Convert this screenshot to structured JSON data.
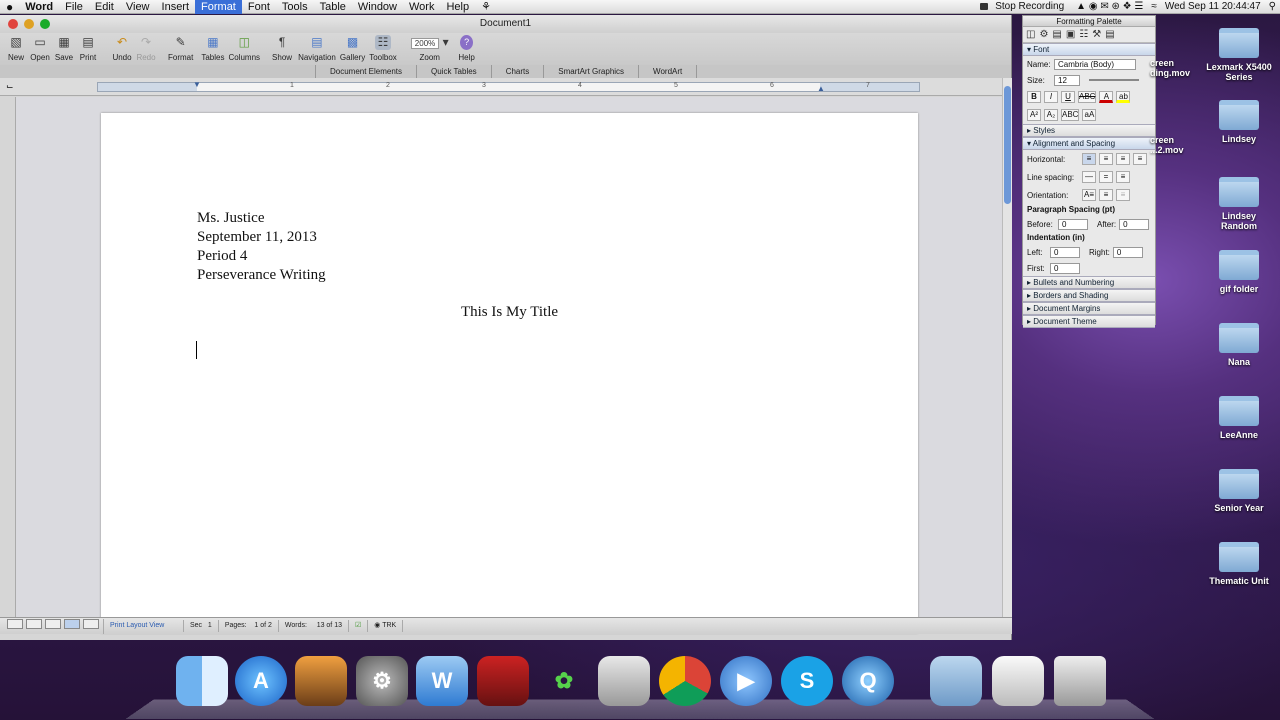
{
  "menubar": {
    "apple": "",
    "app_name": "Word",
    "items": [
      "File",
      "Edit",
      "View",
      "Insert",
      "Format",
      "Font",
      "Tools",
      "Table",
      "Window",
      "Work",
      "Help"
    ],
    "active_item": "Format",
    "script_glyph": "⚘",
    "right": {
      "stop_recording": "Stop Recording",
      "clock": "Wed Sep 11  20:44:47"
    }
  },
  "window": {
    "title": "Document1",
    "toolbar": [
      {
        "label": "New",
        "icon": "new-icon"
      },
      {
        "label": "Open",
        "icon": "open-icon"
      },
      {
        "label": "Save",
        "icon": "save-icon"
      },
      {
        "label": "Print",
        "icon": "print-icon"
      },
      {
        "label": "Undo",
        "icon": "undo-icon"
      },
      {
        "label": "Redo",
        "icon": "redo-icon"
      },
      {
        "label": "Format",
        "icon": "format-icon"
      },
      {
        "label": "Tables",
        "icon": "tables-icon"
      },
      {
        "label": "Columns",
        "icon": "columns-icon"
      },
      {
        "label": "Show",
        "icon": "pilcrow-icon"
      },
      {
        "label": "Navigation",
        "icon": "navigation-icon"
      },
      {
        "label": "Gallery",
        "icon": "gallery-icon"
      },
      {
        "label": "Toolbox",
        "icon": "toolbox-icon"
      },
      {
        "label": "Zoom",
        "icon": "zoom-icon"
      },
      {
        "label": "Help",
        "icon": "help-icon"
      }
    ],
    "zoom_value": "200%",
    "ribbon_tabs": [
      "Document Elements",
      "Quick Tables",
      "Charts",
      "SmartArt Graphics",
      "WordArt"
    ],
    "ruler_numbers": [
      "1",
      "2",
      "3",
      "4",
      "5",
      "6",
      "7"
    ]
  },
  "document": {
    "lines": [
      "Ms. Justice",
      "September 11, 2013",
      "Period 4",
      "Perseverance Writing"
    ],
    "title": "This Is My Title"
  },
  "statusbar": {
    "view": "Print Layout View",
    "sec_label": "Sec",
    "sec_value": "1",
    "pages_label": "Pages:",
    "pages_value": "1 of 2",
    "words_label": "Words:",
    "words_value": "13 of 13",
    "trk": "TRK"
  },
  "palette": {
    "title": "Formatting Palette",
    "font_section": "Font",
    "name_label": "Name:",
    "name_value": "Cambria (Body)",
    "size_label": "Size:",
    "size_value": "12",
    "styles": "Styles",
    "align_section": "Alignment and Spacing",
    "horizontal": "Horizontal:",
    "line_spacing": "Line spacing:",
    "orientation": "Orientation:",
    "para_spacing": "Paragraph Spacing (pt)",
    "before_label": "Before:",
    "before_value": "0",
    "after_label": "After:",
    "after_value": "0",
    "indent": "Indentation (in)",
    "left_label": "Left:",
    "left_value": "0",
    "right_label": "Right:",
    "right_value": "0",
    "first_label": "First:",
    "first_value": "0",
    "bullets": "Bullets and Numbering",
    "borders": "Borders and Shading",
    "margins": "Document Margins",
    "theme": "Document Theme"
  },
  "desktop": {
    "items": [
      "Lexmark X5400 Series",
      "Lindsey",
      "Lindsey Random",
      "gif folder",
      "Nana",
      "LeeAnne",
      "Senior Year",
      "Thematic Unit"
    ],
    "partial_labels": [
      "creen",
      "ding.mov",
      "creen",
      "...2.mov"
    ]
  },
  "dock": {
    "items": [
      "finder-icon",
      "app-store-icon",
      "iphoto-icon",
      "system-preferences-icon",
      "word-icon",
      "photo-booth-icon",
      "messages-icon",
      "photos-icon",
      "chrome-icon",
      "facetime-icon",
      "skype-icon",
      "quicktime-icon",
      "applications-folder-icon",
      "documents-icon",
      "trash-icon"
    ]
  }
}
